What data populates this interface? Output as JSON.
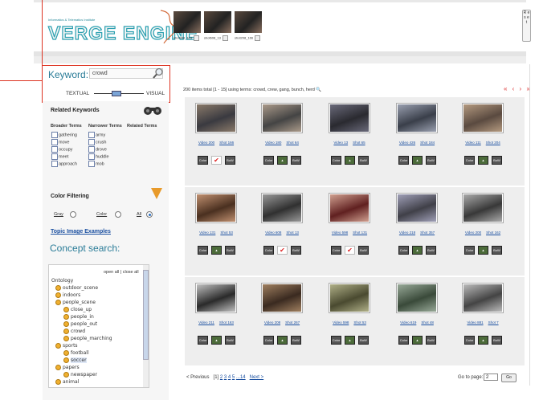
{
  "header": {
    "logo_small": "Informatics & Telematics Institute",
    "logo": "VERGE ENGINE",
    "selected_shots": [
      {
        "label": "shot998_103"
      },
      {
        "label": "shot608_13"
      },
      {
        "label": "shot208_166"
      }
    ],
    "reset_label": "R e s e t"
  },
  "keyword": {
    "label": "Keyword:",
    "value": "crowd",
    "textual_label": "TEXTUAL",
    "visual_label": "VISUAL",
    "slider_value": 0.4
  },
  "related": {
    "title": "Related Keywords",
    "headers": [
      "Broader Terms",
      "Narrower Terms",
      "Related Terms"
    ],
    "broader": [
      "gathering",
      "move",
      "occupy",
      "meet",
      "approach"
    ],
    "narrower": [
      "army",
      "crush",
      "drove",
      "huddle",
      "mob"
    ]
  },
  "color_filter": {
    "title": "Color Filtering",
    "options": [
      "Gray",
      "Color",
      "All"
    ],
    "selected": "All"
  },
  "topic_link": "Topic Image Examples",
  "concept": {
    "title": "Concept search:",
    "open_close": "open all | close all",
    "root": "Ontology",
    "nodes": [
      {
        "label": "outdoor_scene"
      },
      {
        "label": "indoors"
      },
      {
        "label": "people_scene"
      },
      {
        "label": "close_up"
      },
      {
        "label": "people_in"
      },
      {
        "label": "people_out"
      },
      {
        "label": "crowd"
      },
      {
        "label": "people_marching"
      },
      {
        "label": "sports"
      },
      {
        "label": "football"
      },
      {
        "label": "soccer"
      },
      {
        "label": "papers"
      },
      {
        "label": "newspaper"
      },
      {
        "label": "animal"
      }
    ]
  },
  "results": {
    "summary": "200 items total [1 - 15] using terms: crowd, crew, gang, bunch, herd",
    "pager_arrows": "« ‹ › »",
    "button_labels": {
      "color": "Color",
      "mid": "",
      "bow": "BoW"
    },
    "cards": [
      {
        "video": "Video 200",
        "shot": "Shot 166",
        "checked": true
      },
      {
        "video": "Video 180",
        "shot": "Shot 64",
        "checked": false
      },
      {
        "video": "Video 13",
        "shot": "Shot 65",
        "checked": false
      },
      {
        "video": "Video 426",
        "shot": "Shot 184",
        "checked": false
      },
      {
        "video": "Video 111",
        "shot": "Shot 204",
        "checked": false
      },
      {
        "video": "Video 131",
        "shot": "Shot 53",
        "checked": false
      },
      {
        "video": "Video 608",
        "shot": "Shot 13",
        "checked": true
      },
      {
        "video": "Video 598",
        "shot": "Shot 131",
        "checked": true
      },
      {
        "video": "Video 218",
        "shot": "Shot 357",
        "checked": false
      },
      {
        "video": "Video 200",
        "shot": "Shot 162",
        "checked": false
      },
      {
        "video": "Video 211",
        "shot": "Shot 163",
        "checked": false
      },
      {
        "video": "Video 208",
        "shot": "Shot 267",
        "checked": false
      },
      {
        "video": "Video 598",
        "shot": "Shot 53",
        "checked": false
      },
      {
        "video": "Video 619",
        "shot": "Shot 48",
        "checked": false
      },
      {
        "video": "Video 881",
        "shot": "Shot 7",
        "checked": false
      }
    ],
    "pagination": {
      "previous": "< Previous",
      "current": "[1]",
      "pages": [
        "2",
        "3",
        "4",
        "5",
        "...14"
      ],
      "next": "Next >",
      "goto_label": "Go to page:",
      "goto_value": "2",
      "go_button": "Go"
    }
  },
  "colors": {
    "accent": "#2a7c98",
    "callout": "#dd3322",
    "link": "#1a4fa0"
  }
}
